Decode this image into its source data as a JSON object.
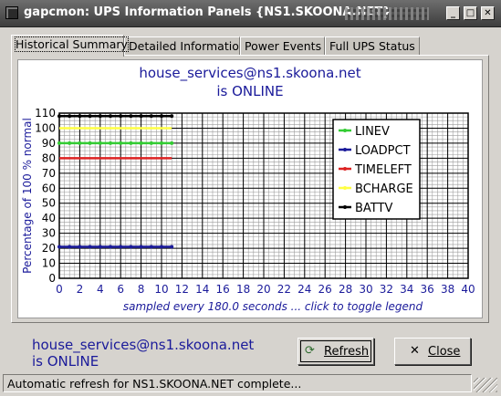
{
  "window": {
    "title": "gapcmon: UPS Information Panels {NS1.SKOONA.NET}"
  },
  "tabs": [
    {
      "label": "Historical Summary"
    },
    {
      "label": "Detailed Information"
    },
    {
      "label": "Power Events"
    },
    {
      "label": "Full UPS Status"
    }
  ],
  "panel": {
    "host": "house_services@ns1.skoona.net",
    "status": "is ONLINE"
  },
  "footer": {
    "host": "house_services@ns1.skoona.net",
    "status": "is ONLINE"
  },
  "buttons": {
    "refresh": "Refresh",
    "close": "Close"
  },
  "statusbar": {
    "text": "Automatic refresh for NS1.SKOONA.NET complete..."
  },
  "colors": {
    "title_blue": "#1a1a9a",
    "linev": "#33cc33",
    "loadpct": "#1a1a9a",
    "timeleft": "#dd2222",
    "bcharge": "#ffff44",
    "battv": "#000000"
  },
  "icons": {
    "refresh": "refresh-arrows-icon",
    "close": "close-x-icon"
  },
  "chart_data": {
    "type": "line",
    "title": "",
    "xlabel": "sampled every 180.0 seconds ... click to toggle legend",
    "ylabel": "Percentage of 100 % normal",
    "xlim": [
      0,
      40
    ],
    "ylim": [
      0,
      110
    ],
    "xticks": [
      0,
      2,
      4,
      6,
      8,
      10,
      12,
      14,
      16,
      18,
      20,
      22,
      24,
      26,
      28,
      30,
      32,
      34,
      36,
      38,
      40
    ],
    "yticks": [
      0,
      10,
      20,
      30,
      40,
      50,
      60,
      70,
      80,
      90,
      100,
      110
    ],
    "grid": true,
    "legend_position": "top-right",
    "x": [
      0,
      1,
      2,
      3,
      4,
      5,
      6,
      7,
      8,
      9,
      10,
      11
    ],
    "series": [
      {
        "name": "LINEV",
        "color": "#33cc33",
        "marker": true,
        "values": [
          90,
          90,
          90,
          90,
          90,
          90,
          90,
          90,
          90,
          90,
          90,
          90
        ]
      },
      {
        "name": "LOADPCT",
        "color": "#1a1a9a",
        "marker": true,
        "values": [
          21,
          21,
          21,
          21,
          21,
          21,
          21,
          21,
          21,
          21,
          21,
          21
        ]
      },
      {
        "name": "TIMELEFT",
        "color": "#dd2222",
        "marker": false,
        "values": [
          80,
          80,
          80,
          80,
          80,
          80,
          80,
          80,
          80,
          80,
          80,
          80
        ]
      },
      {
        "name": "BCHARGE",
        "color": "#ffff44",
        "marker": false,
        "values": [
          100,
          100,
          100,
          100,
          100,
          100,
          100,
          100,
          100,
          100,
          100,
          100
        ]
      },
      {
        "name": "BATTV",
        "color": "#000000",
        "marker": true,
        "values": [
          108,
          108,
          108,
          108,
          108,
          108,
          108,
          108,
          108,
          108,
          108,
          108
        ]
      }
    ]
  }
}
